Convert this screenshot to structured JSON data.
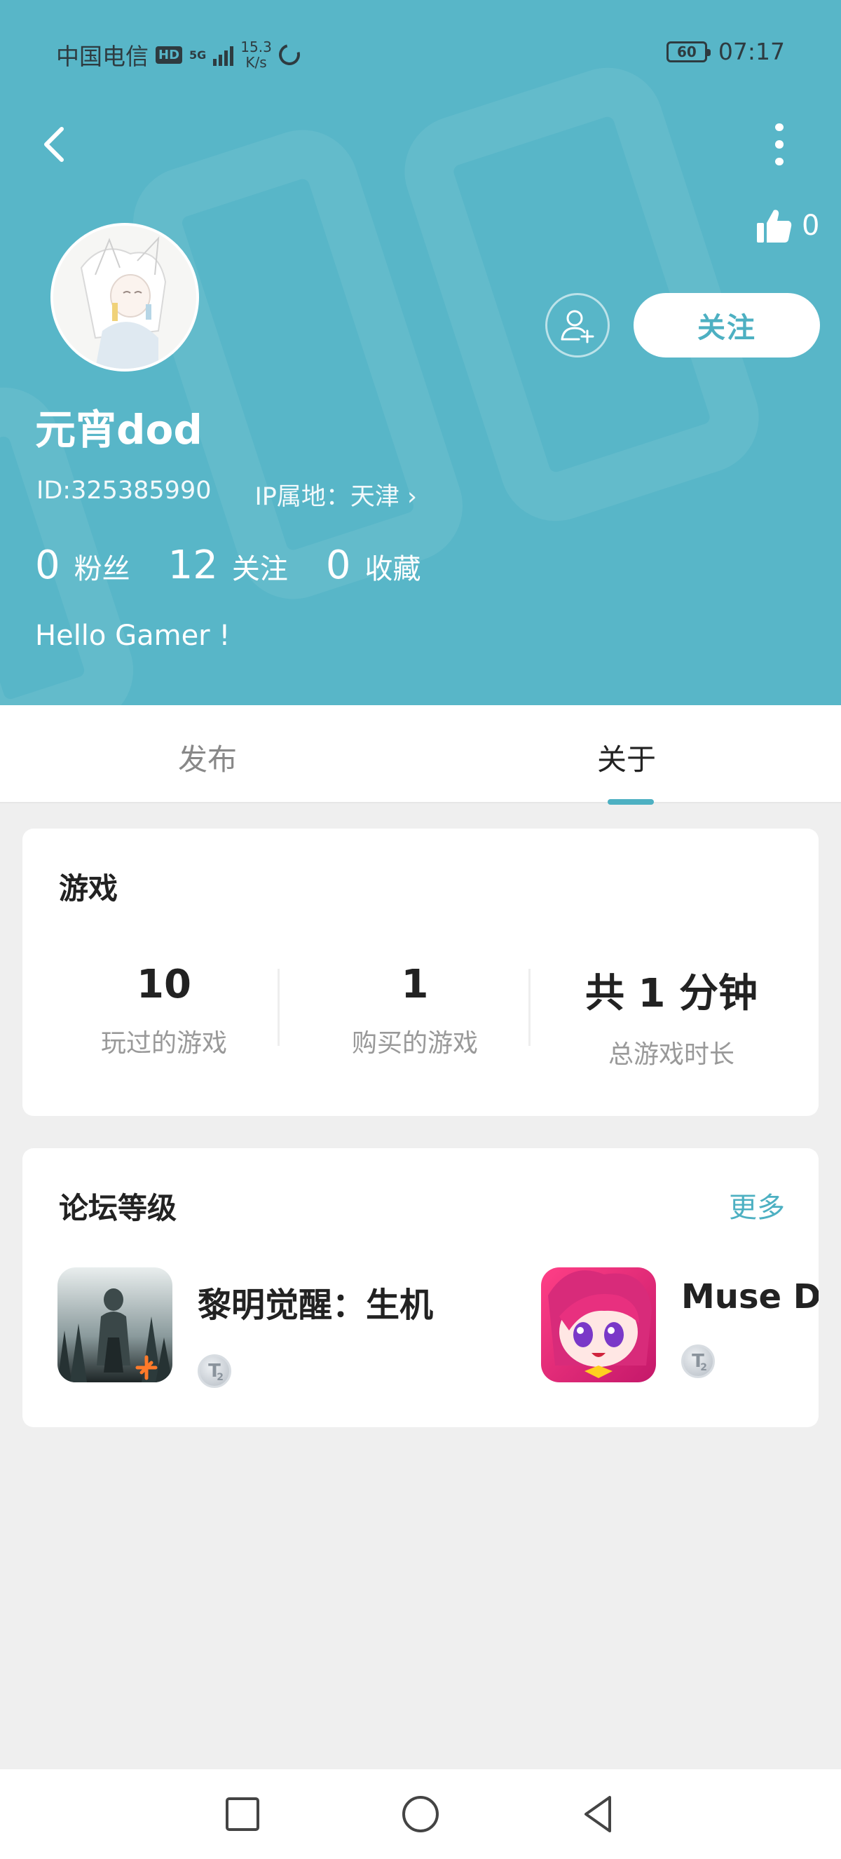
{
  "status_bar": {
    "carrier": "中国电信",
    "hd": "HD",
    "network": "5G",
    "speed_value": "15.3",
    "speed_unit": "K/s",
    "battery": "60",
    "time": "07:17"
  },
  "profile": {
    "likes": "0",
    "follow_button": "关注",
    "username": "元宵dod",
    "id_text": "ID:325385990",
    "ip_text": "IP属地：天津 ›",
    "stats": [
      {
        "num": "0",
        "label": "粉丝"
      },
      {
        "num": "12",
        "label": "关注"
      },
      {
        "num": "0",
        "label": "收藏"
      }
    ],
    "bio": "Hello Gamer !"
  },
  "tabs": [
    "发布",
    "关于"
  ],
  "active_tab": "关于",
  "games_card": {
    "title": "游戏",
    "stats": [
      {
        "value": "10",
        "label": "玩过的游戏"
      },
      {
        "value": "1",
        "label": "购买的游戏"
      },
      {
        "value": "共 1 分钟",
        "label": "总游戏时长"
      }
    ]
  },
  "forum_card": {
    "title": "论坛等级",
    "more": "更多",
    "games": [
      {
        "name": "黎明觉醒：生机",
        "badge": "T",
        "badge_level": "2"
      },
      {
        "name": "Muse Dash",
        "badge": "T",
        "badge_level": "2"
      }
    ]
  },
  "colors": {
    "header_bg": "#58b6c8",
    "accent": "#4db0c2",
    "page_bg": "#efefef"
  },
  "icons": [
    "back-arrow-icon",
    "more-vertical-icon",
    "thumbs-up-icon",
    "add-friend-icon",
    "square-nav-icon",
    "circle-home-icon",
    "triangle-back-icon"
  ]
}
